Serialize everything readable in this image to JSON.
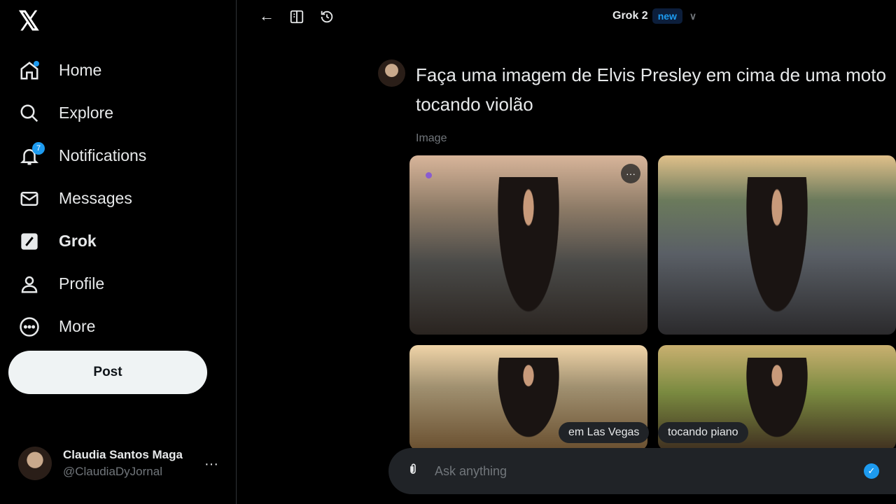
{
  "sidebar": {
    "logo": "𝕏",
    "items": [
      {
        "label": "Home",
        "icon": "home-icon"
      },
      {
        "label": "Explore",
        "icon": "search-icon"
      },
      {
        "label": "Notifications",
        "icon": "bell-icon",
        "badge": "7"
      },
      {
        "label": "Messages",
        "icon": "mail-icon"
      },
      {
        "label": "Grok",
        "icon": "grok-icon"
      },
      {
        "label": "Profile",
        "icon": "person-icon"
      },
      {
        "label": "More",
        "icon": "more-circle-icon"
      }
    ],
    "post_label": "Post",
    "user": {
      "name": "Claudia Santos Maga",
      "handle": "@ClaudiaDyJornal"
    }
  },
  "header": {
    "model": "Grok 2",
    "badge": "new"
  },
  "chat": {
    "question": "Faça uma imagem de Elvis Presley em cima de uma moto tocando violão",
    "image_label": "Image",
    "suggestions": [
      "em Las Vegas",
      "tocando piano"
    ]
  },
  "composer": {
    "placeholder": "Ask anything"
  },
  "colors": {
    "accent": "#1d9bf0",
    "background": "#000000",
    "chip": "#202327"
  }
}
